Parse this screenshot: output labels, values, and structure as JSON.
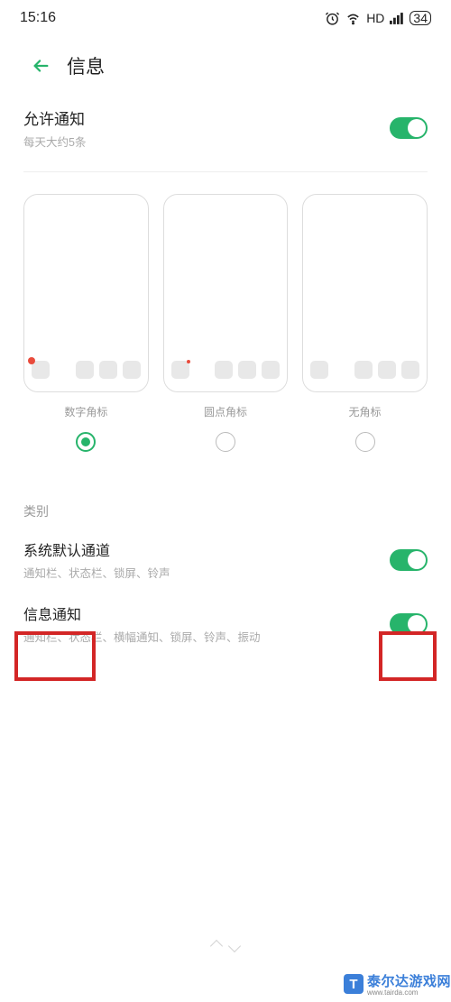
{
  "status_bar": {
    "time": "15:16",
    "hd": "HD",
    "battery": "34"
  },
  "header": {
    "title": "信息"
  },
  "allow": {
    "title": "允许通知",
    "sub": "每天大约5条"
  },
  "previews": [
    {
      "label": "数字角标",
      "selected": true,
      "badge_type": "num"
    },
    {
      "label": "圆点角标",
      "selected": false,
      "badge_type": "dot"
    },
    {
      "label": "无角标",
      "selected": false,
      "badge_type": "none"
    }
  ],
  "category_label": "类别",
  "channels": [
    {
      "title": "系统默认通道",
      "sub": "通知栏、状态栏、锁屏、铃声",
      "on": true
    },
    {
      "title": "信息通知",
      "sub": "通知栏、状态栏、横幅通知、锁屏、铃声、振动",
      "on": true
    }
  ],
  "watermark": {
    "logo_letter": "T",
    "text": "泰尔达游戏网",
    "url": "www.tairda.com"
  }
}
